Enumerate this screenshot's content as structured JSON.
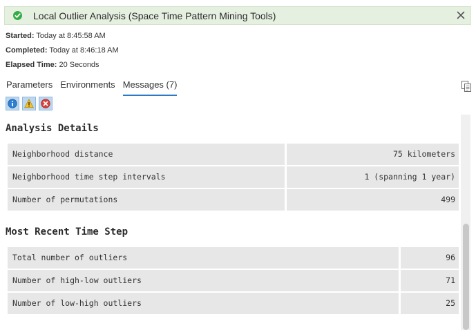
{
  "header": {
    "title": "Local Outlier Analysis (Space Time Pattern Mining Tools)",
    "status_color": "#35ac46"
  },
  "meta": {
    "started_label": "Started:",
    "started_value": "Today at 8:45:58 AM",
    "completed_label": "Completed:",
    "completed_value": "Today at 8:46:18 AM",
    "elapsed_label": "Elapsed Time:",
    "elapsed_value": "20 Seconds"
  },
  "tabs": [
    {
      "label": "Parameters",
      "active": false
    },
    {
      "label": "Environments",
      "active": false
    },
    {
      "label": "Messages (7)",
      "active": true
    }
  ],
  "filters": [
    {
      "icon": "info-icon"
    },
    {
      "icon": "warning-icon"
    },
    {
      "icon": "error-icon"
    }
  ],
  "sections": [
    {
      "title": "Analysis Details",
      "rows": [
        {
          "label": "Neighborhood distance",
          "value": "75 kilometers"
        },
        {
          "label": "Neighborhood time step intervals",
          "value": "1 (spanning 1 year)"
        },
        {
          "label": "Number of permutations",
          "value": "499"
        }
      ]
    },
    {
      "title": "Most Recent Time Step",
      "rows": [
        {
          "label": "Total number of outliers",
          "value": "96"
        },
        {
          "label": "Number of high-low outliers",
          "value": "71"
        },
        {
          "label": "Number of low-high outliers",
          "value": "25"
        }
      ]
    }
  ]
}
